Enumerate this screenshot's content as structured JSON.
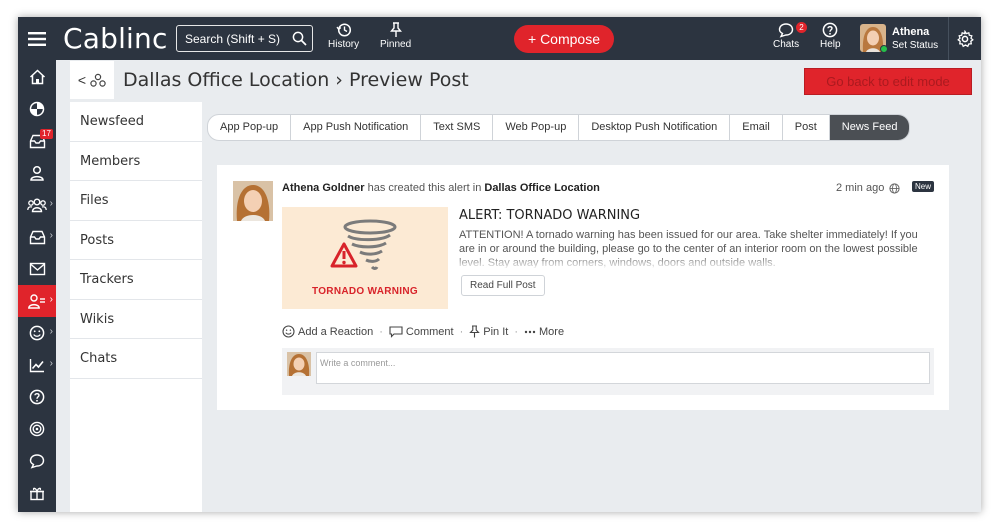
{
  "app": {
    "logo": "Cablinc",
    "search_placeholder": "Search (Shift + S)",
    "history_label": "History",
    "pinned_label": "Pinned",
    "compose_label": "+ Compose",
    "chats_label": "Chats",
    "chats_badge": "2",
    "help_label": "Help",
    "user_name": "Athena",
    "user_status": "Set Status"
  },
  "rail": {
    "inbox_badge": "17"
  },
  "header": {
    "back_symbol": "<",
    "title": "Dallas Office Location › Preview Post",
    "go_back_label": "Go back to edit mode"
  },
  "subnav": {
    "items": [
      "Newsfeed",
      "Members",
      "Files",
      "Posts",
      "Trackers",
      "Wikis",
      "Chats"
    ]
  },
  "tabs": {
    "items": [
      "App Pop-up",
      "App Push Notification",
      "Text SMS",
      "Web Pop-up",
      "Desktop Push Notification",
      "Email",
      "Post",
      "News Feed"
    ],
    "active": "News Feed"
  },
  "post": {
    "author": "Athena Goldner",
    "action_text": "has created this alert in",
    "location": "Dallas Office Location",
    "time": "2 min ago",
    "new_badge": "New",
    "image_caption": "TORNADO WARNING",
    "title": "ALERT: TORNADO WARNING",
    "body": "ATTENTION! A tornado warning has been issued for our area. Take shelter immediately! If you are in or around the building, please go to the center of an interior room on the lowest possible level. Stay away from corners, windows, doors and outside walls.",
    "read_more": "Read Full Post",
    "actions": {
      "reaction": "Add a Reaction",
      "comment": "Comment",
      "pin": "Pin It",
      "more": "More"
    },
    "comment_placeholder": "Write a comment..."
  },
  "colors": {
    "topbar": "#2c3440",
    "accent_red": "#e0242b",
    "active_tab": "#4b4f54",
    "image_bg": "#fcead4"
  }
}
